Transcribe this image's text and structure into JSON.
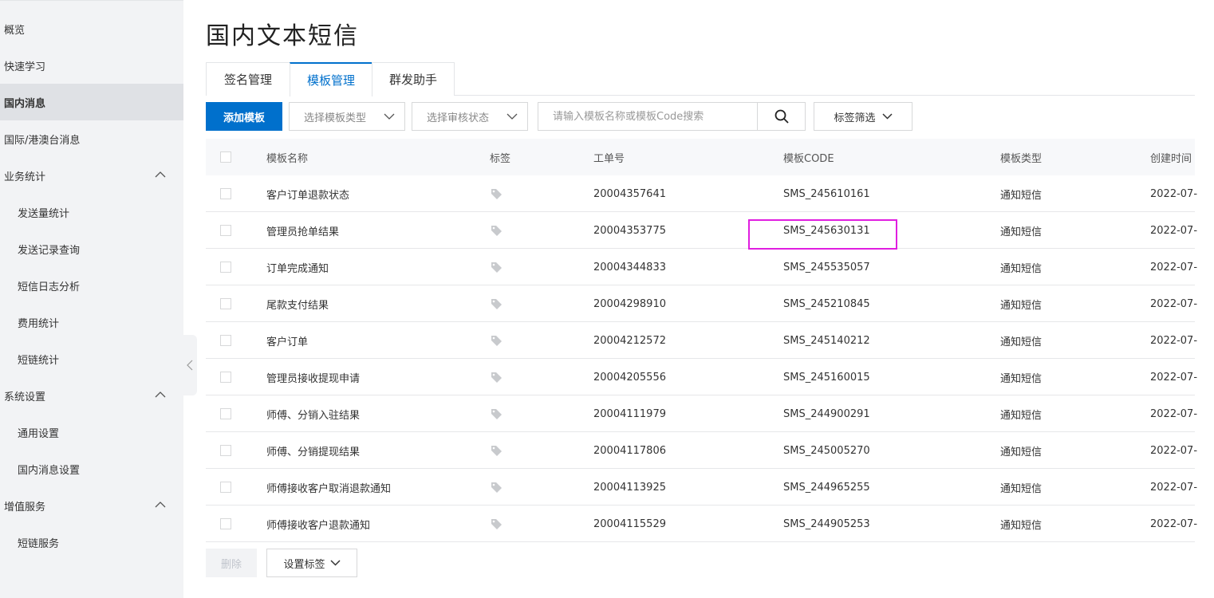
{
  "sidebar": {
    "items": [
      {
        "label": "概览",
        "sub": false
      },
      {
        "label": "快速学习",
        "sub": false
      },
      {
        "label": "国内消息",
        "sub": false,
        "active": true
      },
      {
        "label": "国际/港澳台消息",
        "sub": false
      },
      {
        "label": "业务统计",
        "sub": false,
        "expandable": true
      },
      {
        "label": "发送量统计",
        "sub": true
      },
      {
        "label": "发送记录查询",
        "sub": true
      },
      {
        "label": "短信日志分析",
        "sub": true
      },
      {
        "label": "费用统计",
        "sub": true
      },
      {
        "label": "短链统计",
        "sub": true
      },
      {
        "label": "系统设置",
        "sub": false,
        "expandable": true
      },
      {
        "label": "通用设置",
        "sub": true
      },
      {
        "label": "国内消息设置",
        "sub": true
      },
      {
        "label": "增值服务",
        "sub": false,
        "expandable": true
      },
      {
        "label": "短链服务",
        "sub": true
      }
    ]
  },
  "page": {
    "title": "国内文本短信"
  },
  "tabs": [
    {
      "label": "签名管理"
    },
    {
      "label": "模板管理",
      "active": true
    },
    {
      "label": "群发助手"
    }
  ],
  "toolbar": {
    "add_label": "添加模板",
    "type_select": "选择模板类型",
    "status_select": "选择审核状态",
    "search_placeholder": "请输入模板名称或模板Code搜索",
    "tag_filter": "标签筛选"
  },
  "table": {
    "headers": {
      "name": "模板名称",
      "tag": "标签",
      "order": "工单号",
      "code": "模板CODE",
      "type": "模板类型",
      "time": "创建时间"
    },
    "rows": [
      {
        "name": "客户订单退款状态",
        "order": "20004357641",
        "code": "SMS_245610161",
        "type": "通知短信",
        "time": "2022-07-"
      },
      {
        "name": "管理员抢单结果",
        "order": "20004353775",
        "code": "SMS_245630131",
        "type": "通知短信",
        "time": "2022-07-"
      },
      {
        "name": "订单完成通知",
        "order": "20004344833",
        "code": "SMS_245535057",
        "type": "通知短信",
        "time": "2022-07-"
      },
      {
        "name": "尾款支付结果",
        "order": "20004298910",
        "code": "SMS_245210845",
        "type": "通知短信",
        "time": "2022-07-"
      },
      {
        "name": "客户订单",
        "order": "20004212572",
        "code": "SMS_245140212",
        "type": "通知短信",
        "time": "2022-07-"
      },
      {
        "name": "管理员接收提现申请",
        "order": "20004205556",
        "code": "SMS_245160015",
        "type": "通知短信",
        "time": "2022-07-"
      },
      {
        "name": "师傅、分销入驻结果",
        "order": "20004111979",
        "code": "SMS_244900291",
        "type": "通知短信",
        "time": "2022-07-"
      },
      {
        "name": "师傅、分销提现结果",
        "order": "20004117806",
        "code": "SMS_245005270",
        "type": "通知短信",
        "time": "2022-07-"
      },
      {
        "name": "师傅接收客户取消退款通知",
        "order": "20004113925",
        "code": "SMS_244965255",
        "type": "通知短信",
        "time": "2022-07-"
      },
      {
        "name": "师傅接收客户退款通知",
        "order": "20004115529",
        "code": "SMS_244905253",
        "type": "通知短信",
        "time": "2022-07-"
      }
    ]
  },
  "footer": {
    "delete_label": "删除",
    "set_tag_label": "设置标签"
  },
  "colors": {
    "primary": "#0070cc",
    "highlight": "#e01ee0",
    "tag_icon": "#c8cacd"
  }
}
